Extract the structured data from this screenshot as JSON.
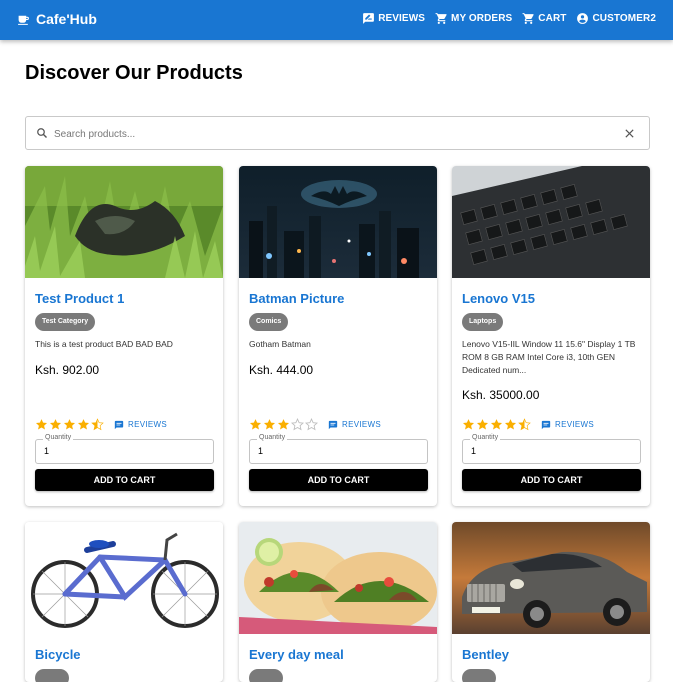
{
  "header": {
    "brand": "Cafe'Hub",
    "nav": [
      {
        "label": "REVIEWS",
        "icon": "rate-review-icon"
      },
      {
        "label": "MY ORDERS",
        "icon": "cart-icon"
      },
      {
        "label": "CART",
        "icon": "cart-icon"
      },
      {
        "label": "CUSTOMER2",
        "icon": "account-icon"
      }
    ]
  },
  "page_title": "Discover Our Products",
  "search": {
    "placeholder": "Search products...",
    "value": ""
  },
  "product_row_1": [
    {
      "name": "Test Product 1",
      "category": "Test Category",
      "description": "This is a test product BAD BAD BAD",
      "price": "Ksh. 902.00",
      "rating": 4.5,
      "reviews_label": "REVIEWS",
      "quantity_label": "Quantity",
      "quantity": "1",
      "add_label": "ADD TO CART"
    },
    {
      "name": "Batman Picture",
      "category": "Comics",
      "description": "Gotham Batman",
      "price": "Ksh. 444.00",
      "rating": 3,
      "reviews_label": "REVIEWS",
      "quantity_label": "Quantity",
      "quantity": "1",
      "add_label": "ADD TO CART"
    },
    {
      "name": "Lenovo V15",
      "category": "Laptops",
      "description": "Lenovo V15-IIL Window 11 15.6\" Display 1 TB ROM 8 GB RAM Intel Core i3, 10th GEN Dedicated num...",
      "price": "Ksh. 35000.00",
      "rating": 4.5,
      "reviews_label": "REVIEWS",
      "quantity_label": "Quantity",
      "quantity": "1",
      "add_label": "ADD TO CART"
    }
  ],
  "product_row_2": [
    {
      "name": "Bicycle"
    },
    {
      "name": "Every day meal"
    },
    {
      "name": "Bentley"
    }
  ],
  "colors": {
    "primary": "#1976d2",
    "star": "#faaf00",
    "star_empty": "#bdbdbd"
  }
}
